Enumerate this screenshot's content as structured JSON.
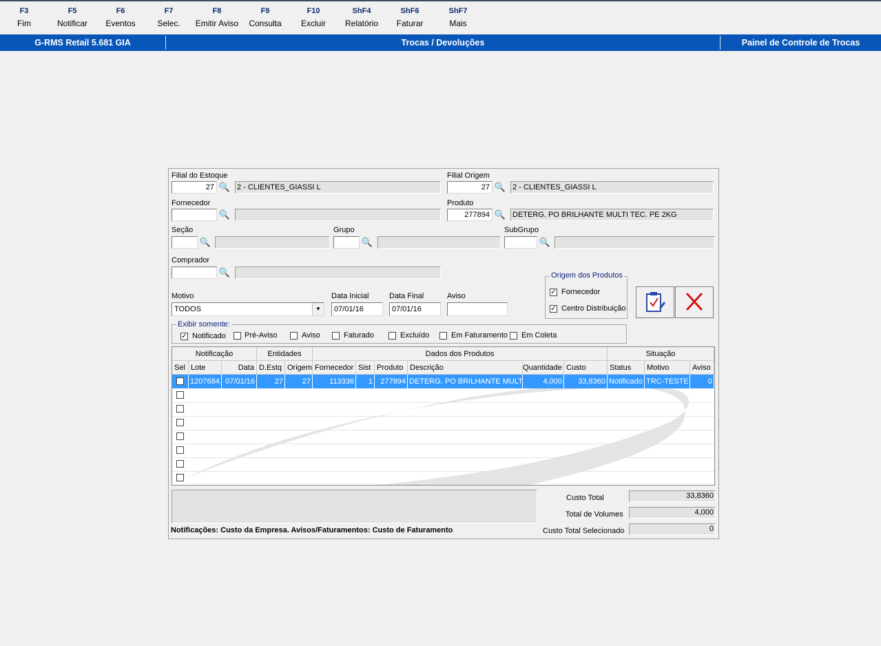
{
  "fkeys": [
    {
      "key": "F3",
      "label": "Fim"
    },
    {
      "key": "F5",
      "label": "Notificar"
    },
    {
      "key": "F6",
      "label": "Eventos"
    },
    {
      "key": "F7",
      "label": "Selec."
    },
    {
      "key": "F8",
      "label": "Emitir Aviso"
    },
    {
      "key": "F9",
      "label": "Consulta"
    },
    {
      "key": "F10",
      "label": "Excluir"
    },
    {
      "key": "ShF4",
      "label": "Relatório"
    },
    {
      "key": "ShF6",
      "label": "Faturar"
    },
    {
      "key": "ShF7",
      "label": "Mais"
    }
  ],
  "titlebar": {
    "app": "G-RMS Retail 5.681 GIA",
    "module": "Trocas / Devoluções",
    "screen": "Painel de Controle de Trocas"
  },
  "form": {
    "filial_estoque": {
      "label": "Filial do Estoque",
      "code": "27",
      "desc": "2 - CLIENTES_GIASSI L"
    },
    "filial_origem": {
      "label": "Filial Origem",
      "code": "27",
      "desc": "2 - CLIENTES_GIASSI L"
    },
    "fornecedor": {
      "label": "Fornecedor",
      "code": "",
      "desc": ""
    },
    "produto": {
      "label": "Produto",
      "code": "277894",
      "desc": "DETERG. PO BRILHANTE MULTI TEC. PE   2KG"
    },
    "secao": {
      "label": "Seção",
      "code": "",
      "desc": ""
    },
    "grupo": {
      "label": "Grupo",
      "code": "",
      "desc": ""
    },
    "subgrupo": {
      "label": "SubGrupo",
      "code": "",
      "desc": ""
    },
    "comprador": {
      "label": "Comprador",
      "code": "",
      "desc": ""
    },
    "motivo": {
      "label": "Motivo",
      "value": "TODOS"
    },
    "data_inicial": {
      "label": "Data Inicial",
      "value": "07/01/16"
    },
    "data_final": {
      "label": "Data Final",
      "value": "07/01/16"
    },
    "aviso": {
      "label": "Aviso",
      "value": ""
    }
  },
  "origem": {
    "title": "Origem dos  Produtos",
    "fornecedor": {
      "label": "Fornecedor",
      "checked": true
    },
    "centro": {
      "label": "Centro Distribuição",
      "checked": true
    }
  },
  "exibir": {
    "title": "Exibir somente:",
    "options": [
      {
        "label": "Notificado",
        "checked": true
      },
      {
        "label": "Pré-Aviso",
        "checked": false
      },
      {
        "label": "Aviso",
        "checked": false
      },
      {
        "label": "Faturado",
        "checked": false
      },
      {
        "label": "Excluído",
        "checked": false
      },
      {
        "label": "Em Faturamento",
        "checked": false
      },
      {
        "label": "Em Coleta",
        "checked": false
      }
    ]
  },
  "grid": {
    "groups": [
      "Notificação",
      "Entidades",
      "Dados dos Produtos",
      "Situação"
    ],
    "columns": [
      "Sel",
      "Lote",
      "Data",
      "D.Estq",
      "Origem",
      "Fornecedor",
      "Sist",
      "Produto",
      "Descrição",
      "Quantidade",
      "Custo",
      "Status",
      "Motivo",
      "Aviso"
    ],
    "rows": [
      {
        "sel": false,
        "lote": "1207684",
        "data": "07/01/16",
        "destq": "27",
        "origem": "27",
        "fornecedor": "113336",
        "sist": "1",
        "produto": "277894",
        "descricao": "DETERG. PO BRILHANTE MULTI TE",
        "quantidade": "4,000",
        "custo": "33,8360",
        "status": "Notificado",
        "motivo": "TRC-TESTE D",
        "aviso": "0"
      }
    ]
  },
  "footer": {
    "note": "Notificações: Custo da Empresa. Avisos/Faturamentos: Custo de Faturamento",
    "custo_total": {
      "label": "Custo Total",
      "value": "33,8360"
    },
    "total_volumes": {
      "label": "Total de Volumes",
      "value": "4,000"
    },
    "custo_selecionado": {
      "label": "Custo Total Selecionado",
      "value": "0"
    }
  }
}
